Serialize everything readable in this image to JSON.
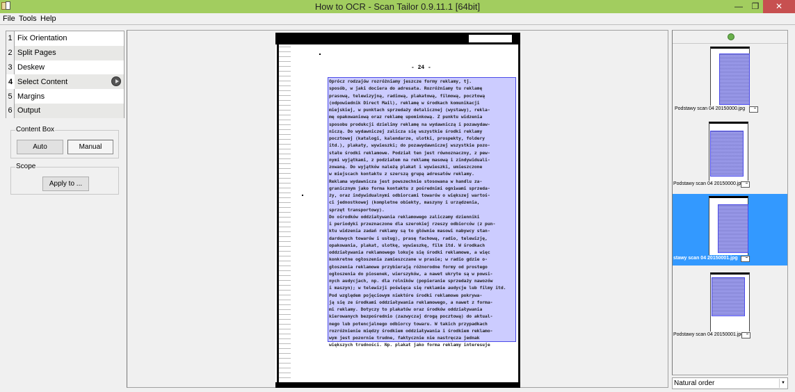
{
  "window": {
    "title": "How to OCR - Scan Tailor 0.9.11.1 [64bit]",
    "minimize_glyph": "—",
    "maximize_glyph": "❐",
    "close_glyph": "✕"
  },
  "menu": [
    "File",
    "Tools",
    "Help"
  ],
  "stages": [
    {
      "num": "1",
      "label": "Fix Orientation"
    },
    {
      "num": "2",
      "label": "Split Pages"
    },
    {
      "num": "3",
      "label": "Deskew"
    },
    {
      "num": "4",
      "label": "Select Content",
      "active": true
    },
    {
      "num": "5",
      "label": "Margins"
    },
    {
      "num": "6",
      "label": "Output"
    }
  ],
  "content_box": {
    "title": "Content Box",
    "auto_label": "Auto",
    "manual_label": "Manual",
    "selected": "Manual"
  },
  "scope": {
    "title": "Scope",
    "apply_label": "Apply to ..."
  },
  "page": {
    "number": "- 24 -",
    "lines": [
      "      Oprócz rodzajów rozróżniamy jeszcze formy reklamy, tj.",
      "sposób, w jaki dociera do adresata. Rozróżniamy tu reklamę",
      "prasową, telewizyjną, radiową, plakatową, filmową, pocztową",
      "(odpowiednik Direct Mail), reklamę w środkach komunikacji",
      "miejskiej, w punktach sprzedaży detalicznej (wystawy), rekla-",
      "mę opakowaniową oraz reklamę upominkową. Z punktu widzenia",
      "sposobu produkcji dzielimy reklamę na wydawniczą i pozawydaw-",
      "niczą. Do wydawniczej zalicza się wszystkie środki reklamy",
      "pocztowej (katalogi, kalendarze, ulotki, prospekty, foldery",
      "itd.), plakaty, wywieszki; do pozawydawniczej wszystkie pozo-",
      "stałe środki reklamowe. Podział ten jest równoznaczny, z pew-",
      "nymi wyjątkami, z podziałem na reklamę masową i zindywiduali-",
      "zowaną. Do wyjątków należą plakat i wywieszki, umieszczone",
      "w miejscach kontaktu z szerszą grupą adresatów reklamy.",
      "      Reklama wydawnicza jest powszechnie stosowana w handlu za-",
      "granicznym jako forma kontaktu z pośrednimi ogniwami sprzeda-",
      "ży, oraz indywidualnymi odbiorcami towarów o większej wartoś-",
      "ci jednostkowej (kompletne obiekty, maszyny i urządzenia,",
      "sprzęt transportowy).",
      "      Do ośrodków oddziaływania reklamowego zaliczamy dzienniki",
      "i periodyki przeznaczone dla szerokiej rzeszy odbiorców (z pun-",
      "ktu widzenia zadań reklamy są to głównie masowi nabywcy stan-",
      "dardowych towarów i usług), prasę fachową, radio, telewizję,",
      "opakowania, plakat, ulotkę, wywieszkę, film itd.  W środkach",
      "oddziaływania reklamowego lokuje się środki reklamowe, a więc",
      "konkretne ogłoszenia zamieszczane w prasie; w radio gdzie o-",
      "głoszenia reklamowe przybierają różnorodne formy od prostego",
      "ogłoszenia do piosenek, wierszyków, a nawet ukryte są w powsi-",
      "nych audycjach, np. dla rolników (popieranie sprzedaży nawozów",
      "i maszyn); w telewizji poświęca się reklamie audycje lub filmy itd.",
      "      Pod względem pojęciowym niektóre środki reklamowe pokrywa-",
      "ją się ze środkami oddziaływania reklamowego, a nawet z forma-",
      "mi reklamy. Dotyczy to plakatów oraz środków oddziaływania",
      "kierowanych bezpośrednio (zazwyczaj drogą pocztową) do aktual-",
      "nego lub potencjalnego odbiorcy towaru. W takich przypadkach",
      "rozróżnienie między środkiem oddziaływania i środkiem reklamo-",
      "wym jest pozornie trudne, faktycznie nie nastręcza jednak",
      "większych trudności. Np. plakat jako forma reklamy interesuje"
    ]
  },
  "thumbnails": [
    {
      "label": "Podstawy scan 04 20150000.jpg",
      "selected": false
    },
    {
      "label": "Podstawy scan 04 20150000.jpg",
      "selected": false
    },
    {
      "label": "stawy scan 04 20150001.jpg",
      "selected": true
    },
    {
      "label": "Podstawy scan 04 20150001.jpg",
      "selected": false
    }
  ],
  "sort": {
    "selected": "Natural order",
    "arrow_glyph": "▼"
  }
}
